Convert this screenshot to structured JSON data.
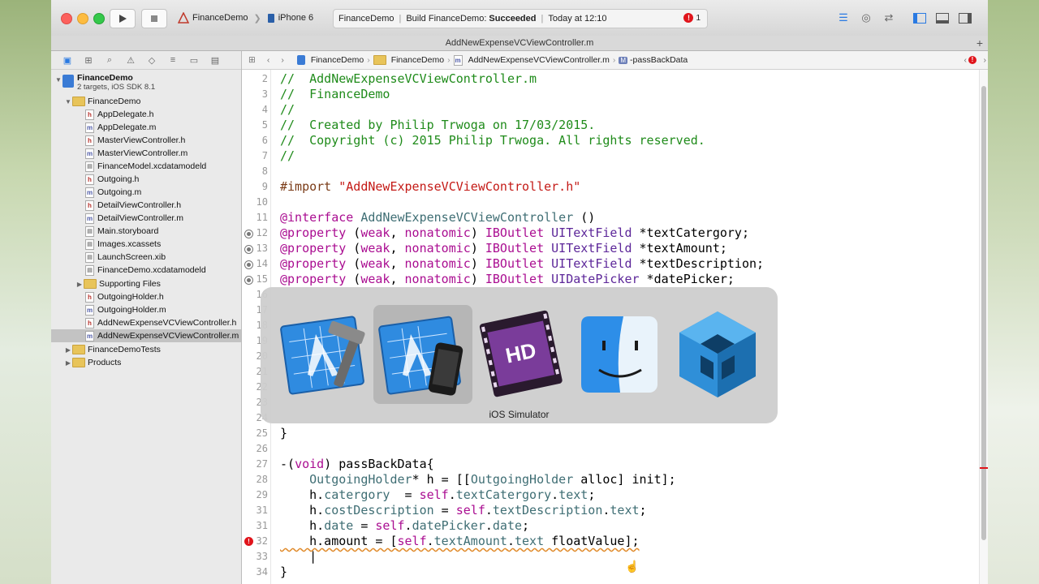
{
  "toolbar": {
    "run_icon": "play-icon",
    "stop_icon": "stop-icon",
    "scheme_name": "FinanceDemo",
    "device_name": "iPhone 6",
    "activity": {
      "project": "FinanceDemo",
      "build_prefix": "Build FinanceDemo: ",
      "build_status": "Succeeded",
      "time": "Today at 12:10",
      "issue_count": "1"
    }
  },
  "tab": {
    "title": "AddNewExpenseVCViewController.m",
    "add_label": "+"
  },
  "navigator": {
    "project": {
      "name": "FinanceDemo",
      "subtitle": "2 targets, iOS SDK 8.1"
    },
    "items": [
      {
        "label": "FinanceDemo",
        "kind": "folder",
        "open": true
      },
      {
        "label": "AppDelegate.h",
        "kind": "h"
      },
      {
        "label": "AppDelegate.m",
        "kind": "m"
      },
      {
        "label": "MasterViewController.h",
        "kind": "h"
      },
      {
        "label": "MasterViewController.m",
        "kind": "m"
      },
      {
        "label": "FinanceModel.xcdatamodeld",
        "kind": "g"
      },
      {
        "label": "Outgoing.h",
        "kind": "h"
      },
      {
        "label": "Outgoing.m",
        "kind": "m"
      },
      {
        "label": "DetailViewController.h",
        "kind": "h"
      },
      {
        "label": "DetailViewController.m",
        "kind": "m"
      },
      {
        "label": "Main.storyboard",
        "kind": "g"
      },
      {
        "label": "Images.xcassets",
        "kind": "g"
      },
      {
        "label": "LaunchScreen.xib",
        "kind": "g"
      },
      {
        "label": "FinanceDemo.xcdatamodeld",
        "kind": "g"
      },
      {
        "label": "Supporting Files",
        "kind": "folder",
        "open": false
      },
      {
        "label": "OutgoingHolder.h",
        "kind": "h"
      },
      {
        "label": "OutgoingHolder.m",
        "kind": "m"
      },
      {
        "label": "AddNewExpenseVCViewController.h",
        "kind": "h"
      },
      {
        "label": "AddNewExpenseVCViewController.m",
        "kind": "m",
        "selected": true
      },
      {
        "label": "FinanceDemoTests",
        "kind": "folder",
        "open": false
      },
      {
        "label": "Products",
        "kind": "folder",
        "open": false
      }
    ]
  },
  "jumpbar": {
    "items": [
      "FinanceDemo",
      "FinanceDemo",
      "AddNewExpenseVCViewController.m",
      "-passBackData"
    ],
    "method_badge": "M"
  },
  "editor": {
    "lines": [
      {
        "n": "2",
        "html": "<span class='c-com'>//  AddNewExpenseVCViewController.m</span>"
      },
      {
        "n": "3",
        "html": "<span class='c-com'>//  FinanceDemo</span>"
      },
      {
        "n": "4",
        "html": "<span class='c-com'>//</span>"
      },
      {
        "n": "5",
        "html": "<span class='c-com'>//  Created by Philip Trwoga on 17/03/2015.</span>"
      },
      {
        "n": "6",
        "html": "<span class='c-com'>//  Copyright (c) 2015 Philip Trwoga. All rights reserved.</span>"
      },
      {
        "n": "7",
        "html": "<span class='c-com'>//</span>"
      },
      {
        "n": "8",
        "html": ""
      },
      {
        "n": "9",
        "html": "<span class='c-pre'>#import </span><span class='c-str'>\"AddNewExpenseVCViewController.h\"</span>"
      },
      {
        "n": "10",
        "html": ""
      },
      {
        "n": "11",
        "html": "<span class='c-kw'>@interface</span> <span class='c-cls'>AddNewExpenseVCViewController</span> ()"
      },
      {
        "n": "12",
        "outlet": true,
        "html": "<span class='c-kw'>@property</span> (<span class='c-kw'>weak</span>, <span class='c-kw'>nonatomic</span>) <span class='c-kw'>IBOutlet</span> <span class='c-type'>UITextField</span> *textCatergory;"
      },
      {
        "n": "13",
        "outlet": true,
        "html": "<span class='c-kw'>@property</span> (<span class='c-kw'>weak</span>, <span class='c-kw'>nonatomic</span>) <span class='c-kw'>IBOutlet</span> <span class='c-type'>UITextField</span> *textAmount;"
      },
      {
        "n": "14",
        "outlet": true,
        "html": "<span class='c-kw'>@property</span> (<span class='c-kw'>weak</span>, <span class='c-kw'>nonatomic</span>) <span class='c-kw'>IBOutlet</span> <span class='c-type'>UITextField</span> *textDescription;"
      },
      {
        "n": "15",
        "outlet": true,
        "html": "<span class='c-kw'>@property</span> (<span class='c-kw'>weak</span>, <span class='c-kw'>nonatomic</span>) <span class='c-kw'>IBOutlet</span> <span class='c-type'>UIDatePicker</span> *datePicker;"
      },
      {
        "n": "16",
        "html": ""
      },
      {
        "n": "17",
        "html": ""
      },
      {
        "n": "18",
        "html": ""
      },
      {
        "n": "19",
        "html": ""
      },
      {
        "n": "20",
        "html": ""
      },
      {
        "n": "21",
        "html": ""
      },
      {
        "n": "22",
        "html": ""
      },
      {
        "n": "23",
        "html": ""
      },
      {
        "n": "24",
        "html": ""
      },
      {
        "n": "25",
        "html": "}"
      },
      {
        "n": "26",
        "html": ""
      },
      {
        "n": "27",
        "html": "-(<span class='c-kw'>void</span>) passBackData{"
      },
      {
        "n": "28",
        "html": "    <span class='c-cls'>OutgoingHolder</span>* h = [[<span class='c-cls'>OutgoingHolder</span> alloc] init];"
      },
      {
        "n": "29",
        "html": "    h.<span class='c-prop'>catergory</span>  = <span class='c-kw'>self</span>.<span class='c-prop'>textCatergory</span>.<span class='c-prop'>text</span>;"
      },
      {
        "n": "31",
        "html": "    h.<span class='c-prop'>costDescription</span> = <span class='c-kw'>self</span>.<span class='c-prop'>textDescription</span>.<span class='c-prop'>text</span>;"
      },
      {
        "n": "31",
        "html": "    h.<span class='c-prop'>date</span> = <span class='c-kw'>self</span>.<span class='c-prop'>datePicker</span>.<span class='c-prop'>date</span>;"
      },
      {
        "n": "32",
        "error": true,
        "html": "    h.amount = [<span class='c-kw'>self</span>.<span class='c-prop'>textAmount</span>.<span class='c-prop'>text</span> floatValue];"
      },
      {
        "n": "33",
        "html": "    |"
      },
      {
        "n": "34",
        "html": "}"
      }
    ]
  },
  "app_switcher": {
    "apps": [
      {
        "name": "Xcode",
        "icon": "xcode-icon"
      },
      {
        "name": "iOS Simulator",
        "icon": "ios-simulator-icon",
        "selected": true
      },
      {
        "name": "HD Video",
        "icon": "hd-video-icon"
      },
      {
        "name": "Finder",
        "icon": "finder-icon"
      },
      {
        "name": "VirtualBox",
        "icon": "virtualbox-icon"
      }
    ],
    "selected_label": "iOS Simulator"
  }
}
